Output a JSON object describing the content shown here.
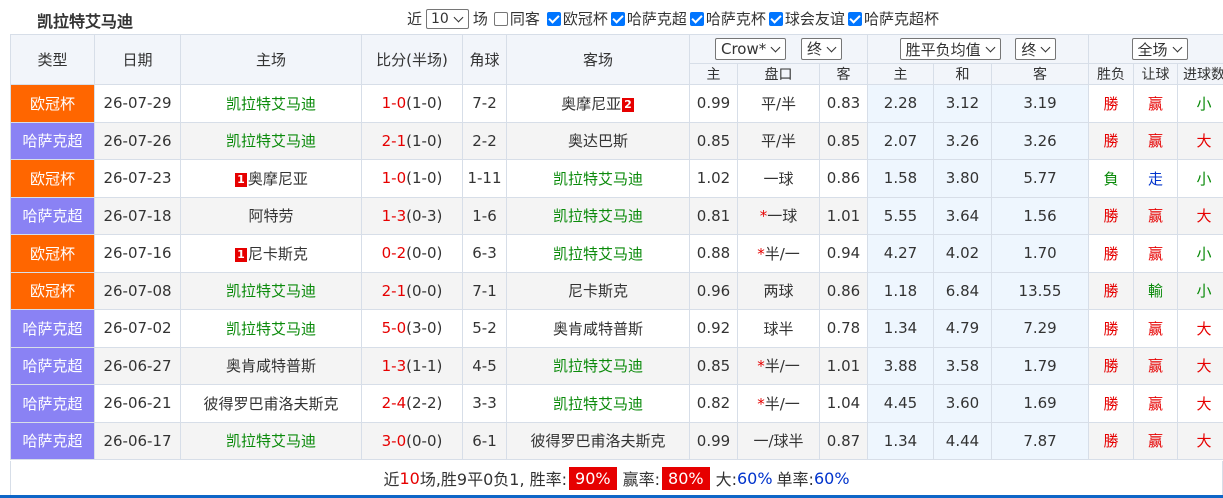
{
  "title": "凯拉特艾马迪",
  "filters": {
    "recent_label": "近",
    "count_value": "10",
    "matches_label": "场",
    "same_home_label": "同客",
    "checkboxes": [
      {
        "label": "欧冠杯",
        "checked": true
      },
      {
        "label": "哈萨克超",
        "checked": true
      },
      {
        "label": "哈萨克杯",
        "checked": true
      },
      {
        "label": "球会友谊",
        "checked": true
      },
      {
        "label": "哈萨克超杯",
        "checked": true
      }
    ]
  },
  "columns": {
    "type": "类型",
    "date": "日期",
    "home": "主场",
    "score": "比分(半场)",
    "corner": "角球",
    "away": "客场",
    "company": "Crow*",
    "handicap_mode": "终",
    "avg_label": "胜平负均值",
    "avg_mode": "终",
    "scope": "全场",
    "sub": {
      "home_odds": "主",
      "line": "盘口",
      "away_odds": "客",
      "win": "主",
      "draw": "和",
      "lose": "客",
      "result": "胜负",
      "cover": "让球",
      "goals": "进球数"
    }
  },
  "rows": [
    {
      "type": "欧冠杯",
      "league": "euro",
      "date": "26-07-29",
      "home": "凯拉特艾马迪",
      "home_green": true,
      "home_red": "",
      "score": "1-0",
      "half": "(1-0)",
      "corner": "7-2",
      "away": "奥摩尼亚",
      "away_green": false,
      "away_red": "2",
      "ho": "0.99",
      "line": "平/半",
      "line_star": false,
      "ao": "0.83",
      "w": "2.28",
      "d": "3.12",
      "l": "3.19",
      "res": "勝",
      "res_c": "red",
      "cov": "赢",
      "cov_c": "red",
      "gl": "小",
      "gl_c": "green"
    },
    {
      "type": "哈萨克超",
      "league": "kzpl",
      "date": "26-07-26",
      "home": "凯拉特艾马迪",
      "home_green": true,
      "home_red": "",
      "score": "2-1",
      "half": "(1-0)",
      "corner": "2-2",
      "away": "奥达巴斯",
      "away_green": false,
      "away_red": "",
      "ho": "0.85",
      "line": "平/半",
      "line_star": false,
      "ao": "0.85",
      "w": "2.07",
      "d": "3.26",
      "l": "3.26",
      "res": "勝",
      "res_c": "red",
      "cov": "赢",
      "cov_c": "red",
      "gl": "大",
      "gl_c": "red"
    },
    {
      "type": "欧冠杯",
      "league": "euro",
      "date": "26-07-23",
      "home": "奥摩尼亚",
      "home_green": false,
      "home_red": "1",
      "score": "1-0",
      "half": "(1-0)",
      "corner": "1-11",
      "away": "凯拉特艾马迪",
      "away_green": true,
      "away_red": "",
      "ho": "1.02",
      "line": "一球",
      "line_star": false,
      "ao": "0.86",
      "w": "1.58",
      "d": "3.80",
      "l": "5.77",
      "res": "負",
      "res_c": "green",
      "cov": "走",
      "cov_c": "blue",
      "gl": "小",
      "gl_c": "green"
    },
    {
      "type": "哈萨克超",
      "league": "kzpl",
      "date": "26-07-18",
      "home": "阿特劳",
      "home_green": false,
      "home_red": "",
      "score": "1-3",
      "half": "(0-3)",
      "corner": "1-6",
      "away": "凯拉特艾马迪",
      "away_green": true,
      "away_red": "",
      "ho": "0.81",
      "line": "一球",
      "line_star": true,
      "ao": "1.01",
      "w": "5.55",
      "d": "3.64",
      "l": "1.56",
      "res": "勝",
      "res_c": "red",
      "cov": "赢",
      "cov_c": "red",
      "gl": "大",
      "gl_c": "red"
    },
    {
      "type": "欧冠杯",
      "league": "euro",
      "date": "26-07-16",
      "home": "尼卡斯克",
      "home_green": false,
      "home_red": "1",
      "score": "0-2",
      "half": "(0-0)",
      "corner": "6-3",
      "away": "凯拉特艾马迪",
      "away_green": true,
      "away_red": "",
      "ho": "0.88",
      "line": "半/一",
      "line_star": true,
      "ao": "0.94",
      "w": "4.27",
      "d": "4.02",
      "l": "1.70",
      "res": "勝",
      "res_c": "red",
      "cov": "赢",
      "cov_c": "red",
      "gl": "小",
      "gl_c": "green"
    },
    {
      "type": "欧冠杯",
      "league": "euro",
      "date": "26-07-08",
      "home": "凯拉特艾马迪",
      "home_green": true,
      "home_red": "",
      "score": "2-1",
      "half": "(0-0)",
      "corner": "7-1",
      "away": "尼卡斯克",
      "away_green": false,
      "away_red": "",
      "ho": "0.96",
      "line": "两球",
      "line_star": false,
      "ao": "0.86",
      "w": "1.18",
      "d": "6.84",
      "l": "13.55",
      "res": "勝",
      "res_c": "red",
      "cov": "輸",
      "cov_c": "green",
      "gl": "小",
      "gl_c": "green"
    },
    {
      "type": "哈萨克超",
      "league": "kzpl",
      "date": "26-07-02",
      "home": "凯拉特艾马迪",
      "home_green": true,
      "home_red": "",
      "score": "5-0",
      "half": "(3-0)",
      "corner": "5-2",
      "away": "奥肯咸特普斯",
      "away_green": false,
      "away_red": "",
      "ho": "0.92",
      "line": "球半",
      "line_star": false,
      "ao": "0.78",
      "w": "1.34",
      "d": "4.79",
      "l": "7.29",
      "res": "勝",
      "res_c": "red",
      "cov": "赢",
      "cov_c": "red",
      "gl": "大",
      "gl_c": "red"
    },
    {
      "type": "哈萨克超",
      "league": "kzpl",
      "date": "26-06-27",
      "home": "奥肯咸特普斯",
      "home_green": false,
      "home_red": "",
      "score": "1-3",
      "half": "(1-1)",
      "corner": "4-5",
      "away": "凯拉特艾马迪",
      "away_green": true,
      "away_red": "",
      "ho": "0.85",
      "line": "半/一",
      "line_star": true,
      "ao": "1.01",
      "w": "3.88",
      "d": "3.58",
      "l": "1.79",
      "res": "勝",
      "res_c": "red",
      "cov": "赢",
      "cov_c": "red",
      "gl": "大",
      "gl_c": "red"
    },
    {
      "type": "哈萨克超",
      "league": "kzpl",
      "date": "26-06-21",
      "home": "彼得罗巴甫洛夫斯克",
      "home_green": false,
      "home_red": "",
      "score": "2-4",
      "half": "(2-2)",
      "corner": "3-3",
      "away": "凯拉特艾马迪",
      "away_green": true,
      "away_red": "",
      "ho": "0.82",
      "line": "半/一",
      "line_star": true,
      "ao": "1.04",
      "w": "4.45",
      "d": "3.60",
      "l": "1.69",
      "res": "勝",
      "res_c": "red",
      "cov": "赢",
      "cov_c": "red",
      "gl": "大",
      "gl_c": "red"
    },
    {
      "type": "哈萨克超",
      "league": "kzpl",
      "date": "26-06-17",
      "home": "凯拉特艾马迪",
      "home_green": true,
      "home_red": "",
      "score": "3-0",
      "half": "(0-0)",
      "corner": "6-1",
      "away": "彼得罗巴甫洛夫斯克",
      "away_green": false,
      "away_red": "",
      "ho": "0.99",
      "line": "一/球半",
      "line_star": false,
      "ao": "0.87",
      "w": "1.34",
      "d": "4.44",
      "l": "7.87",
      "res": "勝",
      "res_c": "red",
      "cov": "赢",
      "cov_c": "red",
      "gl": "大",
      "gl_c": "red"
    }
  ],
  "summary": {
    "prefix": "近",
    "count": "10",
    "record": "场,胜9平0负1, 胜率:",
    "win_rate": "90%",
    "cover_label": "赢率:",
    "cover_rate": "80%",
    "big_label": "大:",
    "big_rate": "60%",
    "odd_label": "单率:",
    "odd_rate": "60%"
  }
}
